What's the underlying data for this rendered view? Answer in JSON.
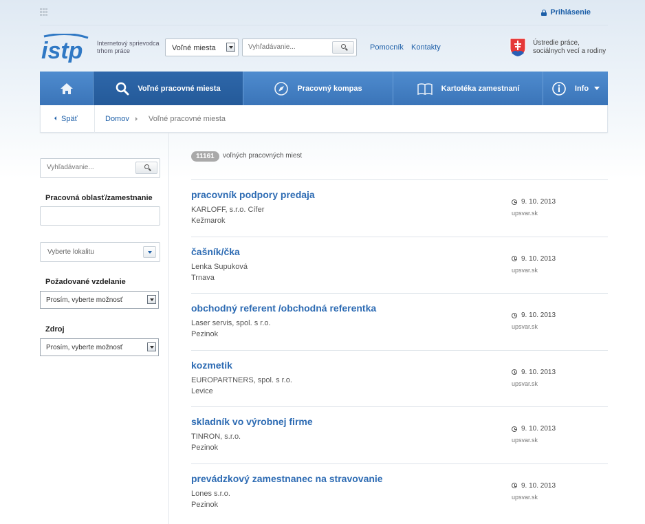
{
  "topbar": {
    "login_label": "Prihlásenie"
  },
  "header": {
    "logo_text": "istp",
    "tagline_line1": "Internetový sprievodca",
    "tagline_line2": "trhom práce",
    "select_value": "Voľné miesta",
    "search_placeholder": "Vyhľadávanie...",
    "links": [
      "Pomocník",
      "Kontakty"
    ],
    "ministry_line1": "Ústredie práce,",
    "ministry_line2": "sociálnych vecí a rodiny"
  },
  "nav": {
    "items": [
      {
        "label": "",
        "icon": "home-icon"
      },
      {
        "label": "Voľné pracovné miesta",
        "icon": "search-icon",
        "active": true
      },
      {
        "label": "Pracovný kompas",
        "icon": "compass-icon"
      },
      {
        "label": "Kartotéka zamestnaní",
        "icon": "book-icon"
      },
      {
        "label": "Info",
        "icon": "info-icon"
      }
    ]
  },
  "breadcrumb": {
    "back_label": "Späť",
    "home_label": "Domov",
    "current_label": "Voľné pracovné miesta"
  },
  "sidebar": {
    "search_placeholder": "Vyhľadávanie...",
    "area_label": "Pracovná oblasť/zamestnanie",
    "location_placeholder": "Vyberte lokalitu",
    "education_label": "Požadované vzdelanie",
    "education_value": "Prosím, vyberte možnosť",
    "source_label": "Zdroj",
    "source_value": "Prosím, vyberte možnosť"
  },
  "results": {
    "count": "11161",
    "count_text": "voľných pracovných miest",
    "jobs": [
      {
        "title": "pracovník podpory predaja",
        "company": "KARLOFF, s.r.o. Cífer",
        "place": "Kežmarok",
        "date": "9. 10. 2013",
        "source": "upsvar.sk"
      },
      {
        "title": "čašník/čka",
        "company": "Lenka Supuková",
        "place": "Trnava",
        "date": "9. 10. 2013",
        "source": "upsvar.sk"
      },
      {
        "title": "obchodný referent /obchodná referentka",
        "company": "Laser servis, spol. s r.o.",
        "place": "Pezinok",
        "date": "9. 10. 2013",
        "source": "upsvar.sk"
      },
      {
        "title": "kozmetik",
        "company": "EUROPARTNERS, spol. s r.o.",
        "place": "Levice",
        "date": "9. 10. 2013",
        "source": "upsvar.sk"
      },
      {
        "title": "skladník vo výrobnej firme",
        "company": "TINRON, s.r.o.",
        "place": "Pezinok",
        "date": "9. 10. 2013",
        "source": "upsvar.sk"
      },
      {
        "title": "prevádzkový zamestnanec na stravovanie",
        "company": "Lones s.r.o.",
        "place": "Pezinok",
        "date": "9. 10. 2013",
        "source": "upsvar.sk"
      }
    ]
  }
}
